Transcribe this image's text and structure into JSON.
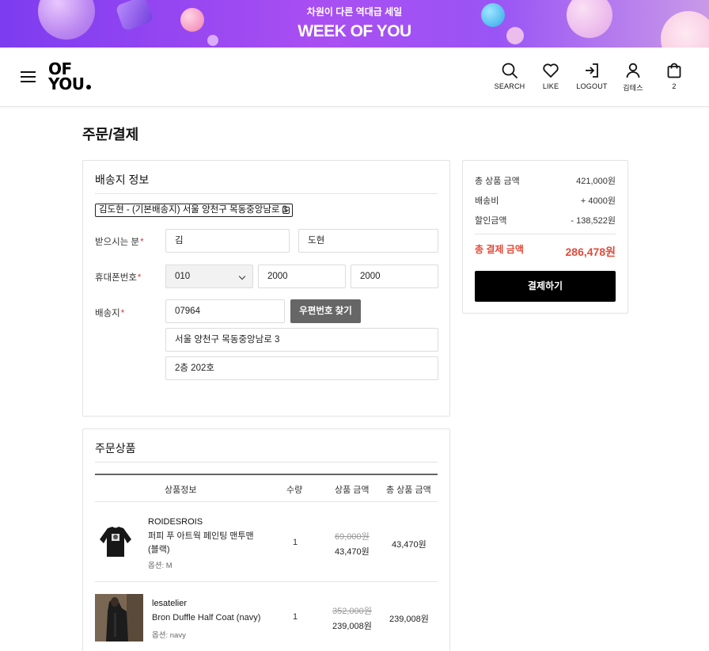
{
  "banner": {
    "subtitle": "차원이 다른 역대급 세일",
    "title": "WEEK OF YOU"
  },
  "header": {
    "logo_line1": "OF",
    "logo_line2": "YOU",
    "nav": [
      {
        "label": "SEARCH",
        "icon": "search-icon"
      },
      {
        "label": "LIKE",
        "icon": "heart-icon"
      },
      {
        "label": "LOGOUT",
        "icon": "logout-icon"
      },
      {
        "label": "김테스",
        "icon": "user-icon"
      },
      {
        "label": "2",
        "icon": "cart-icon"
      }
    ]
  },
  "page": {
    "title": "주문/결제"
  },
  "shipping": {
    "heading": "배송지 정보",
    "address_select": "김도현 - (기본배송지) 서울 양천구 목동중앙남로 3",
    "recipient_label": "받으시는 분",
    "recipient_last": "김",
    "recipient_first": "도현",
    "phone_label": "휴대폰번호",
    "phone_prefix": "010",
    "phone_mid": "2000",
    "phone_last": "2000",
    "address_label": "배송지",
    "zipcode": "07964",
    "zip_button": "우편번호 찾기",
    "address1": "서울 양천구 목동중앙남로 3",
    "address2": "2층 202호",
    "required_mark": "*"
  },
  "summary": {
    "subtotal_label": "총 상품 금액",
    "subtotal_value": "421,000원",
    "shipping_label": "배송비",
    "shipping_value": "+ 4000원",
    "discount_label": "할인금액",
    "discount_value": "- 138,522원",
    "total_label": "총 결제 금액",
    "total_value": "286,478원",
    "pay_button": "결제하기"
  },
  "order_items": {
    "heading": "주문상품",
    "columns": [
      "상품정보",
      "수량",
      "상품 금액",
      "총 상품 금액"
    ],
    "items": [
      {
        "brand": "ROIDESROIS",
        "name_line1": "퍼피 푸 아트웍 페인팅 맨투맨",
        "name_line2": "(블랙)",
        "option": "옵션: M",
        "qty": "1",
        "original_price": "69,000원",
        "sale_price": "43,470원",
        "total": "43,470원"
      },
      {
        "brand": "lesatelier",
        "name_line1": "Bron Duffle Half Coat (navy)",
        "option": "옵션: navy",
        "qty": "1",
        "original_price": "352,000원",
        "sale_price": "239,008원",
        "total": "239,008원"
      }
    ]
  },
  "colors": {
    "banner_purple": "#9b4cf2",
    "required_red": "#e03b3b",
    "total_red": "#e04b3a",
    "pay_button_bg": "#000000",
    "zip_button_bg": "#666666"
  }
}
